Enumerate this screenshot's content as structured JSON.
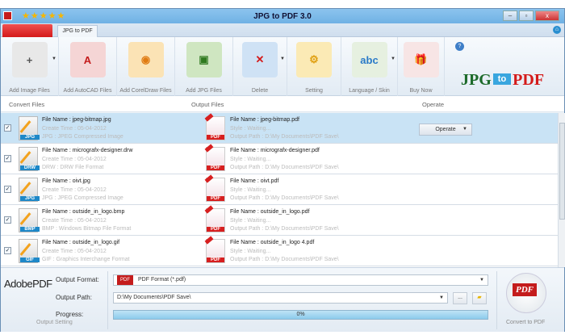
{
  "window": {
    "title": "JPG to PDF 3.0",
    "stars": "★★★★★",
    "controls": [
      "–",
      "▫",
      "x"
    ]
  },
  "tab": "JPG to PDF",
  "toolbar": [
    {
      "id": "add-image-files",
      "label": "Add Image Files",
      "glyph": "+",
      "bg": "#e8e8e8",
      "color": "#555",
      "dropdown": true
    },
    {
      "id": "add-autocad-files",
      "label": "Add AutoCAD Files",
      "glyph": "A",
      "bg": "#f5d5d5",
      "color": "#c41c1c",
      "dropdown": false
    },
    {
      "id": "add-coreldraw-files",
      "label": "Add CorelDraw Files",
      "glyph": "◉",
      "bg": "#fbe3b5",
      "color": "#e07b12",
      "dropdown": false
    },
    {
      "id": "add-jpg-files",
      "label": "Add JPG Files",
      "glyph": "▣",
      "bg": "#cfe6c1",
      "color": "#2f7a1f",
      "dropdown": false
    },
    {
      "id": "delete",
      "label": "Delete",
      "glyph": "✕",
      "bg": "#cfe2f5",
      "color": "#d41a1a",
      "dropdown": true
    },
    {
      "id": "setting",
      "label": "Setting",
      "glyph": "⚙",
      "bg": "#fbeab5",
      "color": "#e0a012",
      "dropdown": false
    },
    {
      "id": "language-skin",
      "label": "Language / Skin",
      "glyph": "abc",
      "bg": "#e6f0e0",
      "color": "#2a7ac8",
      "dropdown": true
    },
    {
      "id": "buy-now",
      "label": "Buy Now",
      "glyph": "🎁",
      "bg": "#f7e5e5",
      "color": "#d41a1a",
      "dropdown": false
    }
  ],
  "help_icon": "?",
  "logo": {
    "a": "JPG",
    "b": "to",
    "c": "PDF"
  },
  "columns": {
    "convert": "Convert Files",
    "output": "Output Files",
    "operate": "Operate"
  },
  "rows": [
    {
      "checked": true,
      "type": "JPG",
      "name": "File Name : jpeg-bitmap.jpg",
      "time": "Create Time : 05-04-2012",
      "format": "JPG : JPEG Compressed Image",
      "out_name": "File Name : jpeg-bitmap.pdf",
      "style": "Style : Waiting...",
      "path": "Output Path : D:\\My Documents\\PDF Save\\",
      "selected": true,
      "operate": "Operate"
    },
    {
      "checked": true,
      "type": "DRW",
      "name": "File Name : micrografx-designer.drw",
      "time": "Create Time : 05-04-2012",
      "format": "DRW : DRW File Format",
      "out_name": "File Name : micrografx-designer.pdf",
      "style": "Style : Waiting...",
      "path": "Output Path : D:\\My Documents\\PDF Save\\"
    },
    {
      "checked": true,
      "type": "JPG",
      "name": "File Name : oivt.jpg",
      "time": "Create Time : 05-04-2012",
      "format": "JPG : JPEG Compressed Image",
      "out_name": "File Name : oivt.pdf",
      "style": "Style : Waiting...",
      "path": "Output Path : D:\\My Documents\\PDF Save\\"
    },
    {
      "checked": true,
      "type": "BMP",
      "name": "File Name : outside_in_logo.bmp",
      "time": "Create Time : 05-04-2012",
      "format": "BMP : Windows Bitmap File Format",
      "out_name": "File Name : outside_in_logo.pdf",
      "style": "Style : Waiting...",
      "path": "Output Path : D:\\My Documents\\PDF Save\\"
    },
    {
      "checked": true,
      "type": "GIF",
      "name": "File Name : outside_in_logo.gif",
      "time": "Create Time : 05-04-2012",
      "format": "GIF : Graphics Interchange Format",
      "out_name": "File Name : outside_in_logo 4.pdf",
      "style": "Style : Waiting...",
      "path": "Output Path : D:\\My Documents\\PDF Save\\"
    }
  ],
  "pdf_badge": "PDF",
  "bottom": {
    "adobe_a": "Adobe",
    "adobe_b": "PDF",
    "output_format_label": "Output Format:",
    "output_format_value": "PDF Format (*.pdf)",
    "output_path_label": "Output Path:",
    "output_path_value": "D:\\My Documents\\PDF Save\\",
    "browse": "...",
    "progress_label": "Progress:",
    "progress_text": "0%",
    "progress": 0,
    "output_setting": "Output Setting",
    "convert_label": "Convert to PDF",
    "convert_icon": "PDF"
  }
}
